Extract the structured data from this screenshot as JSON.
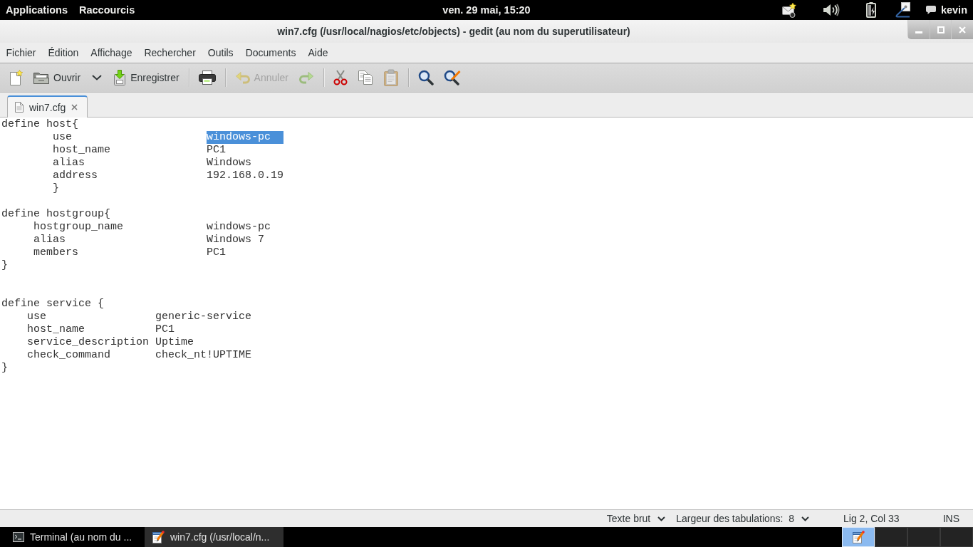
{
  "top_bar": {
    "menus": [
      {
        "label": "Applications"
      },
      {
        "label": "Raccourcis"
      }
    ],
    "clock": "ven. 29 mai, 15:20",
    "user": "kevin"
  },
  "window": {
    "title": "win7.cfg (/usr/local/nagios/etc/objects) - gedit (au nom du superutilisateur)",
    "menu": [
      "Fichier",
      "Édition",
      "Affichage",
      "Rechercher",
      "Outils",
      "Documents",
      "Aide"
    ],
    "toolbar": {
      "groups": [
        {
          "items": [
            {
              "kind": "new",
              "disabled": false
            },
            {
              "kind": "open",
              "label": "Ouvrir",
              "disabled": false
            },
            {
              "kind": "menu",
              "disabled": false
            },
            {
              "kind": "save",
              "label": "Enregistrer",
              "disabled": false
            }
          ]
        },
        {
          "items": [
            {
              "kind": "print",
              "disabled": false
            }
          ]
        },
        {
          "items": [
            {
              "kind": "undo",
              "label": "Annuler",
              "disabled": true
            },
            {
              "kind": "redo",
              "disabled": true
            }
          ]
        },
        {
          "items": [
            {
              "kind": "cut",
              "disabled": false
            },
            {
              "kind": "copy",
              "disabled": false
            },
            {
              "kind": "paste",
              "disabled": true
            }
          ]
        },
        {
          "items": [
            {
              "kind": "find",
              "disabled": false
            },
            {
              "kind": "replace",
              "disabled": false
            }
          ]
        }
      ]
    },
    "tabs": [
      {
        "label": "win7.cfg",
        "selected": true
      }
    ],
    "editor": {
      "lines": [
        {
          "kind": "code",
          "segments": [
            {
              "text": "define host{",
              "selected": false
            }
          ]
        },
        {
          "kind": "code",
          "segments": [
            {
              "text": "\tuse\t\t\t",
              "selected": false
            },
            {
              "text": "windows-pc  ",
              "selected": true
            }
          ]
        },
        {
          "kind": "code",
          "segments": [
            {
              "text": "\thost_name\t\tPC1",
              "selected": false
            }
          ]
        },
        {
          "kind": "code",
          "segments": [
            {
              "text": "\talias\t\t\tWindows",
              "selected": false
            }
          ]
        },
        {
          "kind": "code",
          "segments": [
            {
              "text": "\taddress\t\t\t192.168.0.19",
              "selected": false
            }
          ]
        },
        {
          "kind": "code",
          "segments": [
            {
              "text": "\t}",
              "selected": false
            }
          ]
        },
        {
          "kind": "blank"
        },
        {
          "kind": "code",
          "segments": [
            {
              "text": "define hostgroup{",
              "selected": false
            }
          ]
        },
        {
          "kind": "code",
          "segments": [
            {
              "text": "     hostgroup_name\t\twindows-pc",
              "selected": false
            }
          ]
        },
        {
          "kind": "code",
          "segments": [
            {
              "text": "     alias\t\t\tWindows 7",
              "selected": false
            }
          ]
        },
        {
          "kind": "code",
          "segments": [
            {
              "text": "     members\t\t\tPC1",
              "selected": false
            }
          ]
        },
        {
          "kind": "code",
          "segments": [
            {
              "text": "}",
              "selected": false
            }
          ]
        },
        {
          "kind": "blank"
        },
        {
          "kind": "blank"
        },
        {
          "kind": "code",
          "segments": [
            {
              "text": "define service {",
              "selected": false
            }
          ]
        },
        {
          "kind": "code",
          "segments": [
            {
              "text": "    use\t\t\tgeneric-service",
              "selected": false
            }
          ]
        },
        {
          "kind": "code",
          "segments": [
            {
              "text": "    host_name\t\tPC1",
              "selected": false
            }
          ]
        },
        {
          "kind": "code",
          "segments": [
            {
              "text": "    service_description Uptime",
              "selected": false
            }
          ]
        },
        {
          "kind": "code",
          "segments": [
            {
              "text": "    check_command\tcheck_nt!UPTIME",
              "selected": false
            }
          ]
        },
        {
          "kind": "code",
          "segments": [
            {
              "text": "}",
              "selected": false
            }
          ]
        }
      ]
    },
    "status_bar": {
      "language": "Texte brut",
      "tab_width": "Largeur des tabulations:  8",
      "position": "Lig 2, Col 33",
      "mode": "INS"
    }
  },
  "taskbar": {
    "windows": [
      {
        "kind": "terminal",
        "label": "Terminal (au nom du ...",
        "selected": false
      },
      {
        "kind": "editor",
        "label": "win7.cfg (/usr/local/n...",
        "selected": true
      }
    ],
    "workspaces": [
      {
        "selected": true
      },
      {
        "selected": false
      },
      {
        "selected": false
      },
      {
        "selected": false
      }
    ]
  }
}
